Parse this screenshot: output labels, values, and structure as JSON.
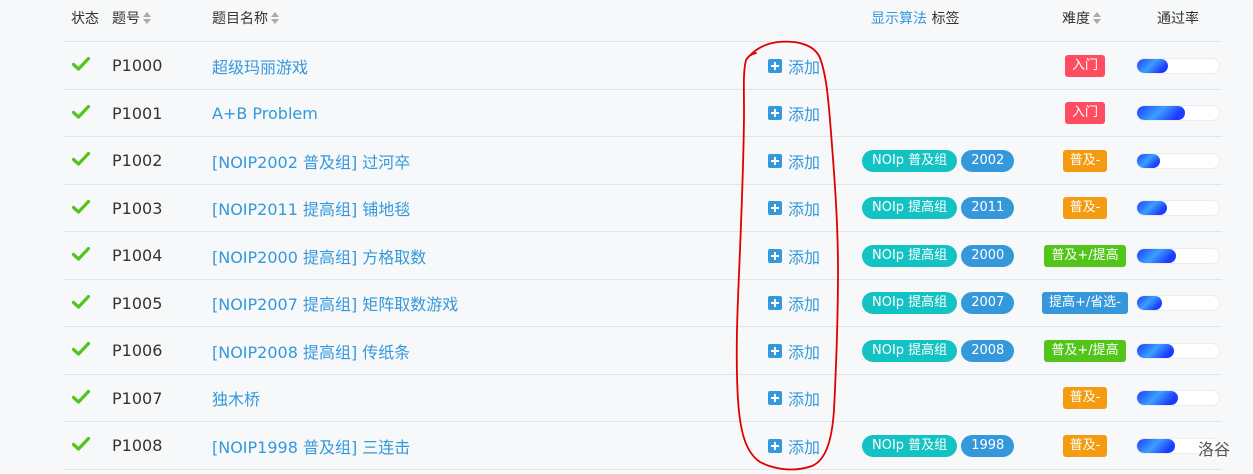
{
  "header": {
    "status": "状态",
    "pid": "题号",
    "title": "题目名称",
    "show_algo": "显示算法",
    "tags": "标签",
    "difficulty": "难度",
    "pass_rate": "通过率"
  },
  "colors": {
    "link": "#3498db",
    "check": "#52c41a",
    "tag_source": "#13c2c2",
    "tag_year": "#3498db",
    "diff_entry": "#fe4c61",
    "diff_popular_minus": "#f39c11",
    "diff_popular_plus": "#52c41a",
    "diff_improve_plus": "#3498db",
    "annotation": "#e00000"
  },
  "add_label": "添加",
  "rows": [
    {
      "status_icon": "check-icon",
      "pid": "P1000",
      "title": "超级玛丽游戏",
      "tags": [],
      "difficulty": "入门",
      "difficulty_color": "#fe4c61",
      "pass_rate": 0.38
    },
    {
      "status_icon": "check-icon",
      "pid": "P1001",
      "title": "A+B Problem",
      "tags": [],
      "difficulty": "入门",
      "difficulty_color": "#fe4c61",
      "pass_rate": 0.58
    },
    {
      "status_icon": "check-icon",
      "pid": "P1002",
      "title": "[NOIP2002 普及组] 过河卒",
      "tags": [
        {
          "label": "NOIp 普及组",
          "kind": "source"
        },
        {
          "label": "2002",
          "kind": "year"
        }
      ],
      "difficulty": "普及-",
      "difficulty_color": "#f39c11",
      "pass_rate": 0.28
    },
    {
      "status_icon": "check-icon",
      "pid": "P1003",
      "title": "[NOIP2011 提高组] 铺地毯",
      "tags": [
        {
          "label": "NOIp 提高组",
          "kind": "source"
        },
        {
          "label": "2011",
          "kind": "year"
        }
      ],
      "difficulty": "普及-",
      "difficulty_color": "#f39c11",
      "pass_rate": 0.36
    },
    {
      "status_icon": "check-icon",
      "pid": "P1004",
      "title": "[NOIP2000 提高组] 方格取数",
      "tags": [
        {
          "label": "NOIp 提高组",
          "kind": "source"
        },
        {
          "label": "2000",
          "kind": "year"
        }
      ],
      "difficulty": "普及+/提高",
      "difficulty_color": "#52c41a",
      "pass_rate": 0.48
    },
    {
      "status_icon": "check-icon",
      "pid": "P1005",
      "title": "[NOIP2007 提高组] 矩阵取数游戏",
      "tags": [
        {
          "label": "NOIp 提高组",
          "kind": "source"
        },
        {
          "label": "2007",
          "kind": "year"
        }
      ],
      "difficulty": "提高+/省选-",
      "difficulty_color": "#3498db",
      "pass_rate": 0.3
    },
    {
      "status_icon": "check-icon",
      "pid": "P1006",
      "title": "[NOIP2008 提高组] 传纸条",
      "tags": [
        {
          "label": "NOIp 提高组",
          "kind": "source"
        },
        {
          "label": "2008",
          "kind": "year"
        }
      ],
      "difficulty": "普及+/提高",
      "difficulty_color": "#52c41a",
      "pass_rate": 0.45
    },
    {
      "status_icon": "check-icon",
      "pid": "P1007",
      "title": "独木桥",
      "tags": [],
      "difficulty": "普及-",
      "difficulty_color": "#f39c11",
      "pass_rate": 0.5
    },
    {
      "status_icon": "check-icon",
      "pid": "P1008",
      "title": "[NOIP1998 普及组] 三连击",
      "tags": [
        {
          "label": "NOIp 普及组",
          "kind": "source"
        },
        {
          "label": "1998",
          "kind": "year"
        }
      ],
      "difficulty": "普及-",
      "difficulty_color": "#f39c11",
      "pass_rate": 0.46
    }
  ],
  "watermark": "洛谷"
}
